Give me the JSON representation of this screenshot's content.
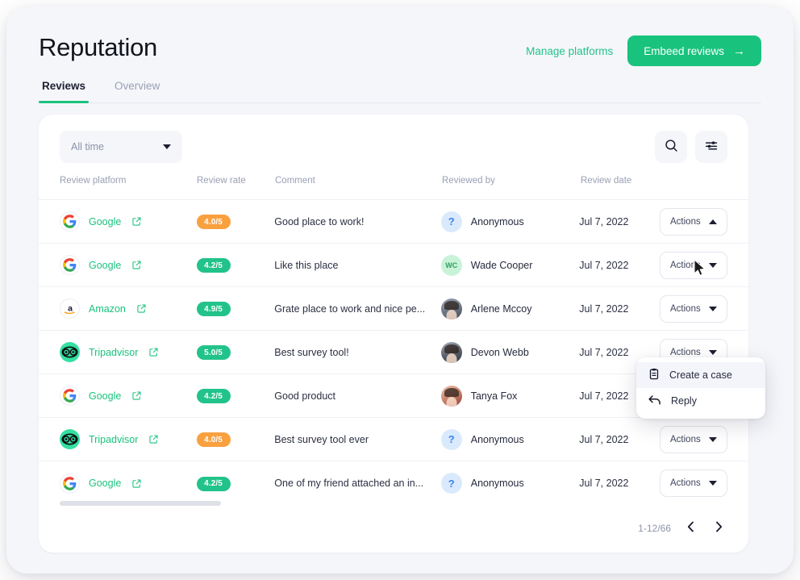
{
  "header": {
    "title": "Reputation",
    "manage_link": "Manage platforms",
    "embeed_button": "Embeed reviews",
    "arrow_glyph": "→"
  },
  "tabs": [
    {
      "label": "Reviews",
      "active": true
    },
    {
      "label": "Overview",
      "active": false
    }
  ],
  "toolbar": {
    "time_filter": "All time",
    "search_icon": "search-icon",
    "filter_icon": "sliders-icon"
  },
  "table": {
    "columns": [
      "Review platform",
      "Review rate",
      "Comment",
      "Reviewed by",
      "Review date"
    ],
    "actions_label": "Actions",
    "rows": [
      {
        "platform": "Google",
        "platform_icon": "google-logo",
        "rate": "4.0/5",
        "rate_color": "orange",
        "comment": "Good place to work!",
        "reviewer": "Anonymous",
        "avatar_type": "anon",
        "avatar_initials": "?",
        "date": "Jul 7, 2022",
        "expanded": true
      },
      {
        "platform": "Google",
        "platform_icon": "google-logo",
        "rate": "4.2/5",
        "rate_color": "green",
        "comment": "Like this place",
        "reviewer": "Wade Cooper",
        "avatar_type": "initials",
        "avatar_initials": "WC",
        "date": "Jul 7, 2022",
        "expanded": false
      },
      {
        "platform": "Amazon",
        "platform_icon": "amazon-logo",
        "rate": "4.9/5",
        "rate_color": "green",
        "comment": "Grate place to work and nice pe...",
        "reviewer": "Arlene Mccoy",
        "avatar_type": "photo-a",
        "avatar_initials": "",
        "date": "Jul 7, 2022",
        "expanded": false
      },
      {
        "platform": "Tripadvisor",
        "platform_icon": "tripadvisor-logo",
        "rate": "5.0/5",
        "rate_color": "green",
        "comment": "Best survey tool!",
        "reviewer": "Devon Webb",
        "avatar_type": "photo-b",
        "avatar_initials": "",
        "date": "Jul 7, 2022",
        "expanded": false
      },
      {
        "platform": "Google",
        "platform_icon": "google-logo",
        "rate": "4.2/5",
        "rate_color": "green",
        "comment": "Good product",
        "reviewer": "Tanya Fox",
        "avatar_type": "photo-c",
        "avatar_initials": "",
        "date": "Jul 7, 2022",
        "expanded": false
      },
      {
        "platform": "Tripadvisor",
        "platform_icon": "tripadvisor-logo",
        "rate": "4.0/5",
        "rate_color": "orange",
        "comment": "Best survey tool ever",
        "reviewer": "Anonymous",
        "avatar_type": "anon",
        "avatar_initials": "?",
        "date": "Jul 7, 2022",
        "expanded": false
      },
      {
        "platform": "Google",
        "platform_icon": "google-logo",
        "rate": "4.2/5",
        "rate_color": "green",
        "comment": "One of my friend attached an in...",
        "reviewer": "Anonymous",
        "avatar_type": "anon",
        "avatar_initials": "?",
        "date": "Jul 7, 2022",
        "expanded": false
      }
    ]
  },
  "dropdown": {
    "items": [
      {
        "label": "Create a case",
        "icon": "clipboard-icon",
        "hovered": true
      },
      {
        "label": "Reply",
        "icon": "reply-arrow-icon",
        "hovered": false
      }
    ]
  },
  "pagination": {
    "count": "1-12/66",
    "prev_icon": "chevron-left-icon",
    "next_icon": "chevron-right-icon"
  },
  "colors": {
    "accent_green": "#19c37d",
    "badge_green": "#22c38a",
    "badge_orange": "#f9a03f",
    "page_bg": "#f5f6fa"
  }
}
